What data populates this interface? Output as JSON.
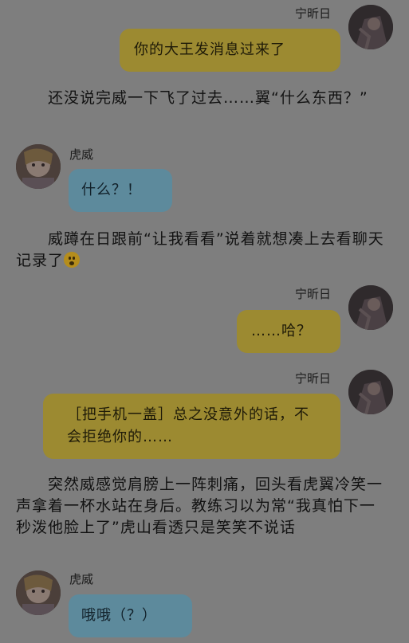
{
  "chat": [
    {
      "type": "msg",
      "side": "right",
      "name": "宁昕日",
      "avatar": "dark-anime-avatar",
      "text": "你的大王发消息过来了"
    },
    {
      "type": "narration",
      "text": "还没说完威一下飞了过去……翼“什么东西？”"
    },
    {
      "type": "msg",
      "side": "left",
      "name": "虎威",
      "avatar": "anime-avatar",
      "text": "什么？！"
    },
    {
      "type": "narration",
      "text": "威蹲在日跟前“让我看看”说着就想凑上去看聊天记录了",
      "emoji": "astonished-face-emoji"
    },
    {
      "type": "msg",
      "side": "right",
      "name": "宁昕日",
      "avatar": "dark-anime-avatar",
      "text": "……哈？"
    },
    {
      "type": "msg",
      "side": "right",
      "name": "宁昕日",
      "avatar": "dark-anime-avatar",
      "text": "［把手机一盖］总之没意外的话，不会拒绝你的……"
    },
    {
      "type": "narration",
      "text": "突然威感觉肩膀上一阵刺痛，回头看虎翼冷笑一声拿着一杯水站在身后。教练习以为常“我真怕下一秒泼他脸上了”虎山看透只是笑笑不说话"
    },
    {
      "type": "msg",
      "side": "left",
      "name": "虎威",
      "avatar": "anime-avatar",
      "text": "哦哦（？）"
    }
  ],
  "colors": {
    "background": "#7e7e7e",
    "right_bubble": "#9c8a31",
    "left_bubble": "#5d8a9c"
  }
}
